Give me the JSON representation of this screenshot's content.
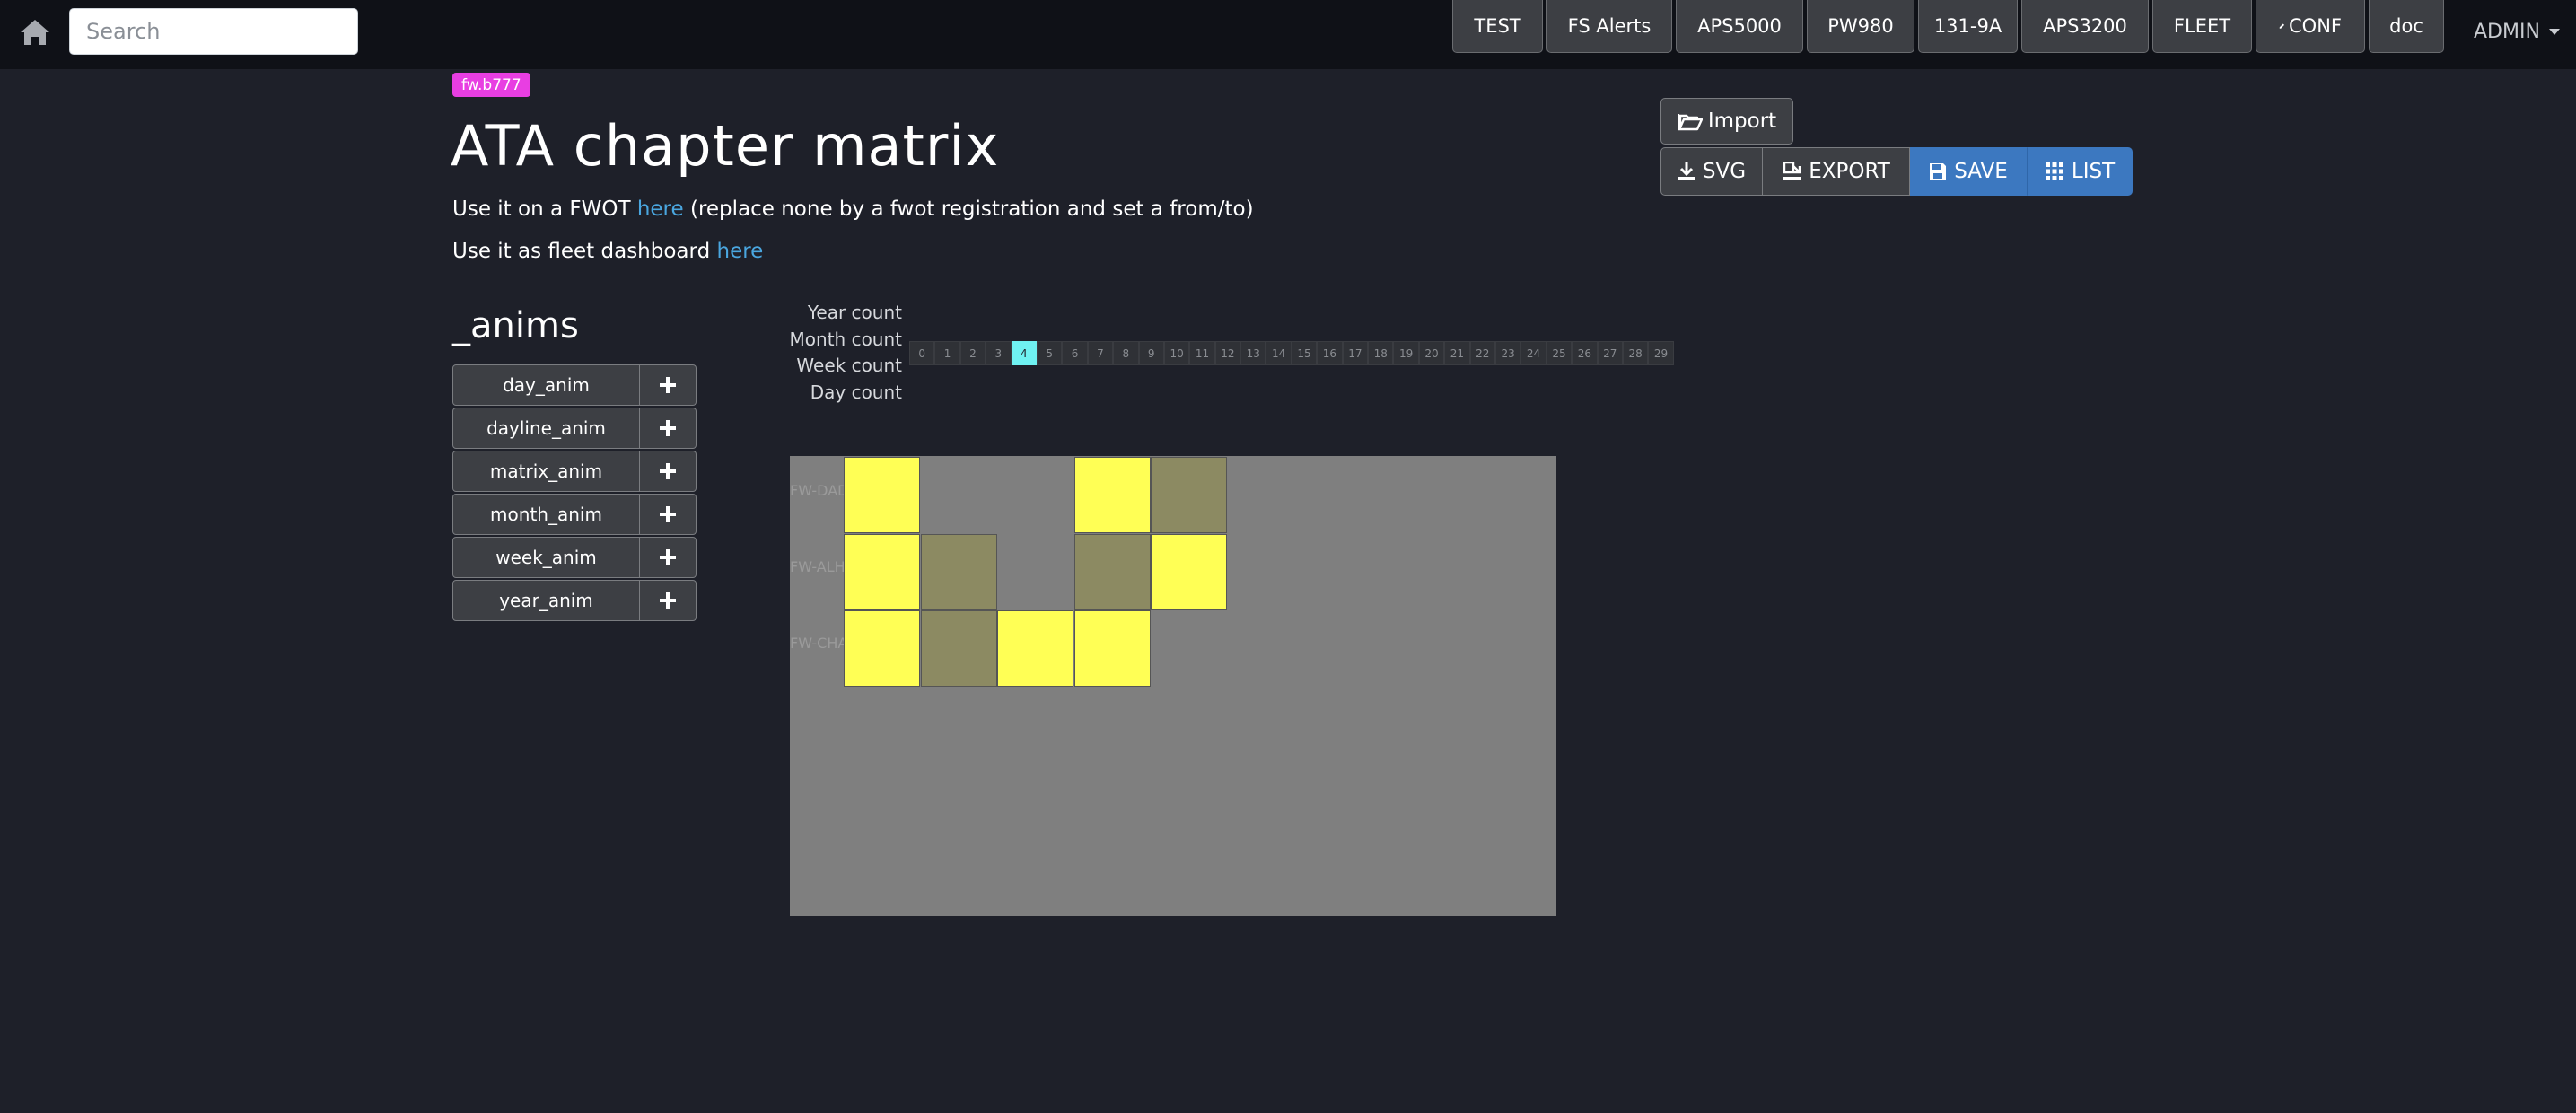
{
  "navbar": {
    "search_placeholder": "Search",
    "buttons": [
      "TEST",
      "FS Alerts",
      "APS5000",
      "PW980",
      "131-9A",
      "APS3200",
      "FLEET",
      "CONF",
      "doc"
    ],
    "admin_label": "ADMIN"
  },
  "header": {
    "badge": "fw.b777",
    "title": "ATA chapter matrix",
    "line1_prefix": "Use it on a FWOT ",
    "line1_link": "here",
    "line1_suffix": " (replace none by a fwot registration and set a from/to)",
    "line2_prefix": "Use it as fleet dashboard ",
    "line2_link": "here"
  },
  "actions": {
    "import": "Import",
    "svg": "SVG",
    "export": "EXPORT",
    "save": "SAVE",
    "list": "LIST"
  },
  "anims": {
    "title": "_anims",
    "items": [
      "day_anim",
      "dayline_anim",
      "matrix_anim",
      "month_anim",
      "week_anim",
      "year_anim"
    ]
  },
  "counters": {
    "labels": [
      "Year count",
      "Month count",
      "Week count",
      "Day count"
    ],
    "month_cells": [
      "0",
      "1",
      "2",
      "3",
      "4",
      "5",
      "6",
      "7",
      "8",
      "9",
      "10",
      "11",
      "12",
      "13",
      "14",
      "15",
      "16",
      "17",
      "18",
      "19",
      "20",
      "21",
      "22",
      "23",
      "24",
      "25",
      "26",
      "27",
      "28",
      "29"
    ],
    "active_month": "4"
  },
  "matrix": {
    "rows": [
      "FW-DAD",
      "FW-ALH",
      "FW-CHA"
    ],
    "cells": [
      [
        "yellow",
        "",
        "",
        "yellow",
        "olive"
      ],
      [
        "yellow",
        "olive",
        "",
        "olive",
        "yellow"
      ],
      [
        "yellow",
        "olive",
        "yellow",
        "yellow",
        ""
      ]
    ]
  },
  "colors": {
    "badge": "#e83ee2",
    "primary": "#3c78c0",
    "link": "#4aa6df",
    "active_cell": "#6ff2f2",
    "cell_yellow": "#ffff55",
    "cell_olive": "#8c8a62",
    "matrix_bg": "#7f7f7f"
  }
}
